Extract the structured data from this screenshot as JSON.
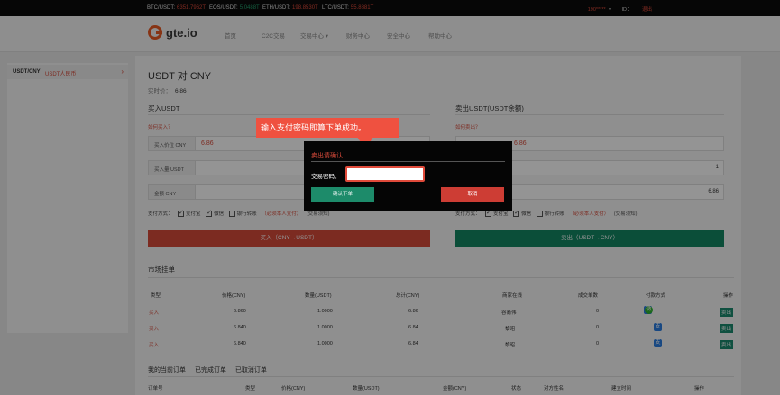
{
  "ticker": [
    {
      "label": "BTC/USDT:",
      "value": "6351.7962T",
      "color": "#e04a3a"
    },
    {
      "label": "EOS/USDT:",
      "value": "5.0488T",
      "color": "#23a36e"
    },
    {
      "label": "ETH/USDT:",
      "value": "198.8530T",
      "color": "#e04a3a"
    },
    {
      "label": "LTC/USDT:",
      "value": "55.8881T",
      "color": "#e04a3a"
    }
  ],
  "user": {
    "account": "190*****",
    "caret": "▾",
    "id": "ID：",
    "logout": "退出"
  },
  "logo": "gte.io",
  "nav": [
    "首页",
    "C2C交易",
    "交易中心 ▾",
    "财务中心",
    "安全中心",
    "帮助中心"
  ],
  "sidebar": {
    "pair": "USDT/CNY",
    "sub": "USDT人民币",
    "arrow": "›"
  },
  "header": {
    "title": "USDT 对 CNY",
    "price_label": "实时价：",
    "price": "6.86"
  },
  "buy": {
    "title": "买入USDT",
    "howto": "如何买入？",
    "price_label": "买入价位 CNY",
    "price": "6.86",
    "amount_label": "买入量 USDT",
    "total_label": "金额 CNY",
    "pay_label": "支付方式：",
    "pay_options": [
      "支付宝",
      "微信",
      "银行转账"
    ],
    "note": "（必须本人支付）",
    "note2": "(交易须知)",
    "button": "买入（CNY→USDT）"
  },
  "sell": {
    "title": "卖出USDT(USDT余额)",
    "howto": "如何卖出？",
    "price": "6.86",
    "amount": "1",
    "total": "6.86",
    "pay_label": "支付方式：",
    "pay_options": [
      "支付宝",
      "微信",
      "银行转账"
    ],
    "note": "（必须本人支付）",
    "note2": "(交易须知)",
    "button": "卖出（USDT→CNY）"
  },
  "market": {
    "title": "市场挂单",
    "columns": [
      "类型",
      "价格(CNY)",
      "数量(USDT)",
      "总计(CNY)",
      "商家在线",
      "成交单数",
      "付款方式",
      "操作"
    ],
    "rows": [
      {
        "type": "买入",
        "price": "6.860",
        "qty": "1.0000",
        "total": "6.86",
        "merchant": "谷裔伟",
        "count": "0",
        "op": "卖出"
      },
      {
        "type": "买入",
        "price": "6.840",
        "qty": "1.0000",
        "total": "6.84",
        "merchant": "黎昭",
        "count": "0",
        "op": "卖出"
      },
      {
        "type": "买入",
        "price": "6.840",
        "qty": "1.0000",
        "total": "6.84",
        "merchant": "黎昭",
        "count": "0",
        "op": "卖出"
      }
    ]
  },
  "orders": {
    "tabs": [
      "我的当前订单",
      "已完成订单",
      "已取消订单"
    ],
    "columns": [
      "订单号",
      "类型",
      "价格(CNY)",
      "数量(USDT)",
      "金额(CNY)",
      "状态",
      "对方姓名",
      "建立时间",
      "操作"
    ]
  },
  "tooltip": "输入支付密码即算下单成功。",
  "dialog": {
    "title": "卖出请确认",
    "pwd_label": "交易密码：",
    "ok": "确认下单",
    "cancel": "取消"
  },
  "icons": {
    "alipay": "支",
    "wechat": "微"
  }
}
